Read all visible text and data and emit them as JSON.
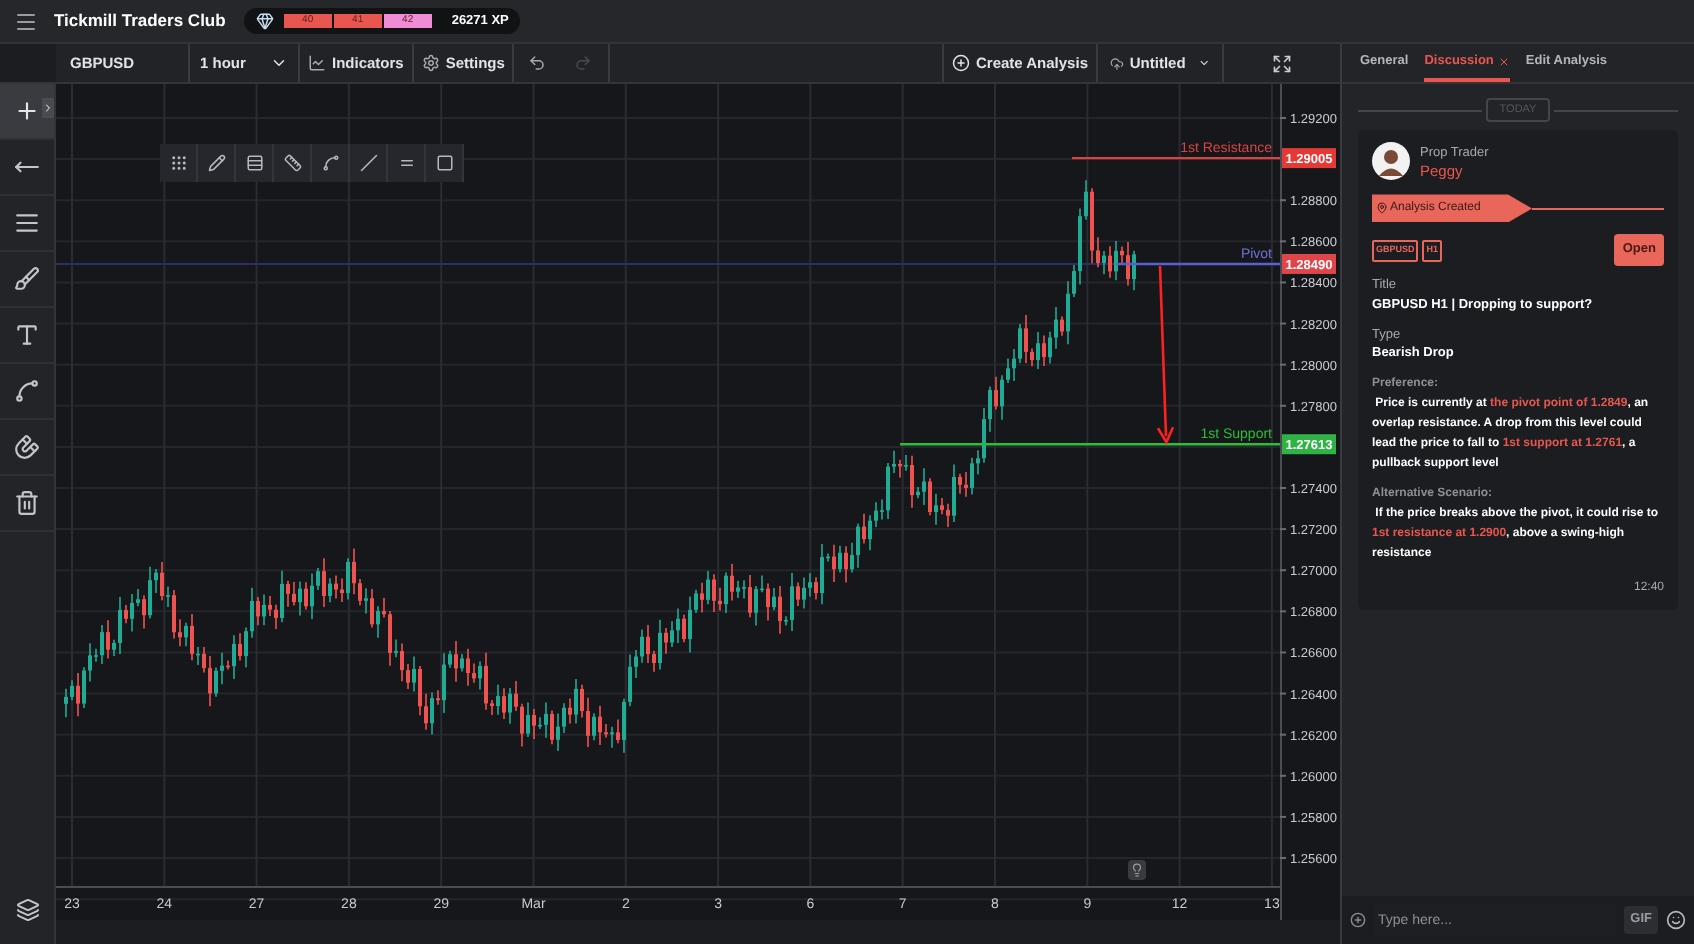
{
  "app": {
    "title": "Tickmill Traders Club",
    "levels": [
      {
        "label": "40",
        "color": "#e8574f"
      },
      {
        "label": "41",
        "color": "#e8574f"
      },
      {
        "label": "42",
        "color": "#f08bd6"
      }
    ],
    "xp": "26271 XP"
  },
  "toolbar": {
    "symbol": "GBPUSD",
    "interval": "1 hour",
    "indicators": "Indicators",
    "settings": "Settings",
    "redo_disabled": true,
    "create": "Create Analysis",
    "file": "Untitled"
  },
  "drawing_tools": [
    {
      "kind": "crosshair",
      "selected": true
    },
    {
      "kind": "line",
      "selected": false
    },
    {
      "kind": "lines",
      "selected": false
    },
    {
      "kind": "brush",
      "selected": false
    },
    {
      "kind": "text",
      "selected": false
    },
    {
      "kind": "pattern",
      "selected": false
    },
    {
      "kind": "magnet",
      "selected": false
    },
    {
      "kind": "trash",
      "selected": false
    }
  ],
  "chart": {
    "price_axis": [
      "1.29200",
      "1.28800",
      "1.28600",
      "1.28400",
      "1.28200",
      "1.28000",
      "1.27800",
      "1.27400",
      "1.27200",
      "1.27000",
      "1.26800",
      "1.26600",
      "1.26400",
      "1.26200",
      "1.26000",
      "1.25800",
      "1.25600"
    ],
    "time_axis": [
      "23",
      "24",
      "27",
      "28",
      "29",
      "Mar",
      "2",
      "3",
      "6",
      "7",
      "8",
      "9",
      "12",
      "13"
    ],
    "levels": [
      {
        "kind": "resistance",
        "label": "1st Resistance",
        "price": "1.29005"
      },
      {
        "kind": "pivot",
        "label": "Pivot",
        "price": "1.28490"
      },
      {
        "kind": "support",
        "label": "1st Support",
        "price": "1.27613"
      }
    ]
  },
  "panel": {
    "tabs": [
      {
        "label": "General",
        "selected": false
      },
      {
        "label": "Discussion",
        "selected": true
      },
      {
        "label": "Edit Analysis",
        "selected": false
      }
    ],
    "divider": "TODAY",
    "message": {
      "role": "Prop Trader",
      "name": "Peggy",
      "event": "Analysis Created",
      "tags": [
        "GBPUSD",
        "H1"
      ],
      "action": "Open",
      "fields": [
        {
          "label": "Title",
          "value": "GBPUSD H1 | Dropping to support?"
        },
        {
          "label": "Type",
          "value": "Bearish Drop"
        }
      ],
      "notes": [
        {
          "label": "Preference:",
          "text": " Price is currently at **the pivot point of 1.2849**, an overlap resistance. A drop from this level could lead the price to fall to **1st support at 1.2761**, a pullback support level"
        },
        {
          "label": "Alternative Scenario:",
          "text": " If the price breaks above the pivot, it could rise to **1st resistance at 1.2900**, above a swing-high resistance"
        }
      ],
      "time": "12:40"
    },
    "composer": {
      "placeholder": "Type here...",
      "gif": "GIF"
    }
  }
}
